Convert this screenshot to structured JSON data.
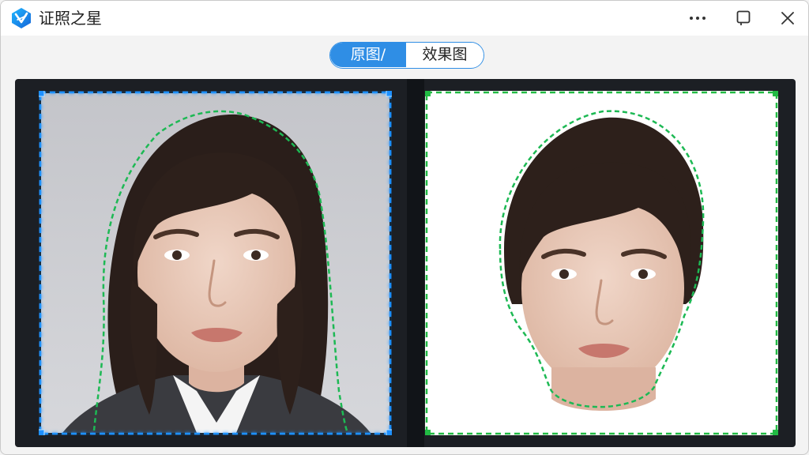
{
  "window": {
    "title": "证照之星",
    "accent_color": "#2f8ee5",
    "buttons": [
      "more-icon",
      "restore-icon",
      "close-icon"
    ]
  },
  "view_toggle": {
    "original_label": "原图/",
    "result_label": "效果图",
    "selected": "original"
  },
  "preview": {
    "left_outline_color": "#1e90ff",
    "right_outline_color": "#22bb44",
    "result_background": "#ffffff"
  }
}
